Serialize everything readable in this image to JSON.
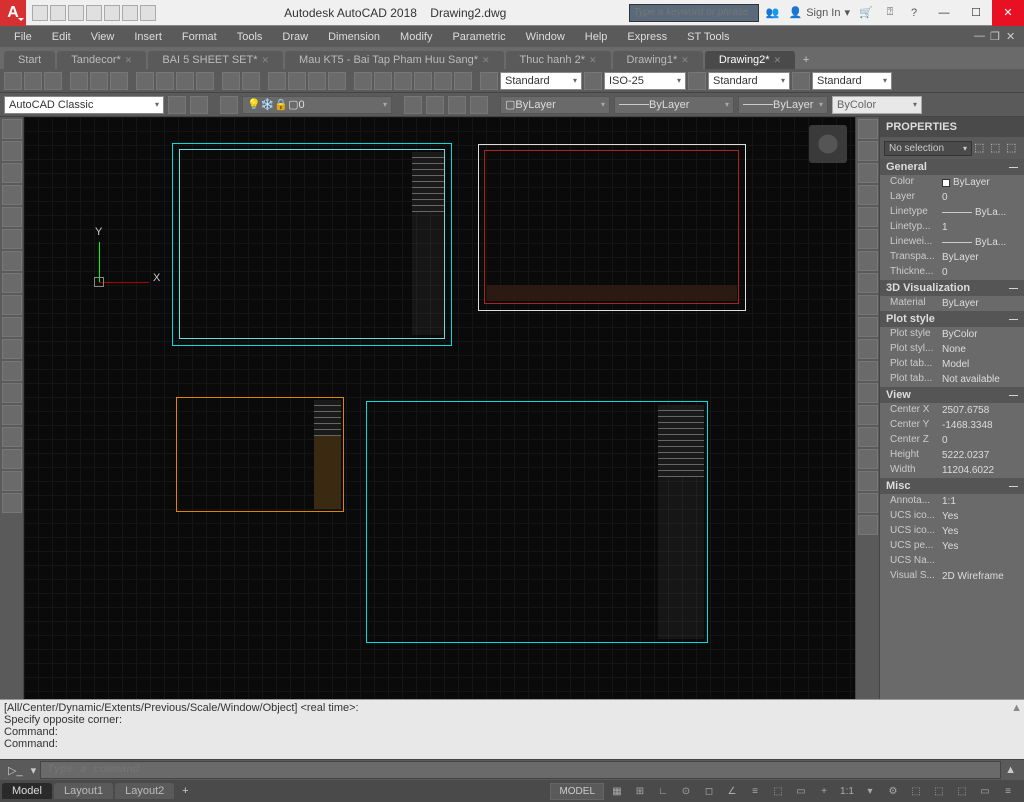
{
  "title": {
    "app": "Autodesk AutoCAD 2018",
    "file": "Drawing2.dwg"
  },
  "search_placeholder": "Type a keyword or phrase",
  "signin": "Sign In",
  "menu": [
    "File",
    "Edit",
    "View",
    "Insert",
    "Format",
    "Tools",
    "Draw",
    "Dimension",
    "Modify",
    "Parametric",
    "Window",
    "Help",
    "Express",
    "ST Tools"
  ],
  "tabs": [
    {
      "label": "Start",
      "active": false,
      "closable": false
    },
    {
      "label": "Tandecor*",
      "active": false,
      "closable": true
    },
    {
      "label": "BAI 5 SHEET SET*",
      "active": false,
      "closable": true
    },
    {
      "label": "Mau KT5 - Bai Tap Pham Huu Sang*",
      "active": false,
      "closable": true
    },
    {
      "label": "Thuc hanh 2*",
      "active": false,
      "closable": true
    },
    {
      "label": "Drawing1*",
      "active": false,
      "closable": true
    },
    {
      "label": "Drawing2*",
      "active": true,
      "closable": true
    }
  ],
  "styles": {
    "text": "Standard",
    "dim": "ISO-25",
    "table": "Standard",
    "ml": "Standard"
  },
  "workspace": "AutoCAD Classic",
  "layer_dropdown": "0",
  "bylayer": {
    "color": "ByLayer",
    "ltype": "ByLayer",
    "lweight": "ByLayer",
    "plotcolor": "ByColor"
  },
  "ucs": {
    "x": "X",
    "y": "Y"
  },
  "props": {
    "title": "PROPERTIES",
    "selection": "No selection",
    "general": {
      "heading": "General",
      "color": "ByLayer",
      "layer": "0",
      "linetype": "ByLa...",
      "linetype_scale": "1",
      "lineweight": "ByLa...",
      "transparency": "ByLayer",
      "thickness": "0"
    },
    "viz3d": {
      "heading": "3D Visualization",
      "material": "ByLayer"
    },
    "plot": {
      "heading": "Plot style",
      "style": "ByColor",
      "style_table": "None",
      "table_attached": "Model",
      "table_type": "Not available"
    },
    "view": {
      "heading": "View",
      "cx": "2507.6758",
      "cy": "-1468.3348",
      "cz": "0",
      "height": "5222.0237",
      "width": "11204.6022"
    },
    "misc": {
      "heading": "Misc",
      "anno": "1:1",
      "ucs_icon_on": "Yes",
      "ucs_icon_origin": "Yes",
      "ucs_per_vp": "Yes",
      "ucs_name": "",
      "visual_style": "2D Wireframe"
    }
  },
  "cmd": {
    "h1": "[All/Center/Dynamic/Extents/Previous/Scale/Window/Object] <real time>:",
    "h2": "Specify opposite corner:",
    "h3": "Command:",
    "h4": "Command:",
    "placeholder": "Type a command"
  },
  "layouts": {
    "model": "Model",
    "l1": "Layout1",
    "l2": "Layout2"
  },
  "status": {
    "model": "MODEL",
    "scale": "1:1"
  }
}
